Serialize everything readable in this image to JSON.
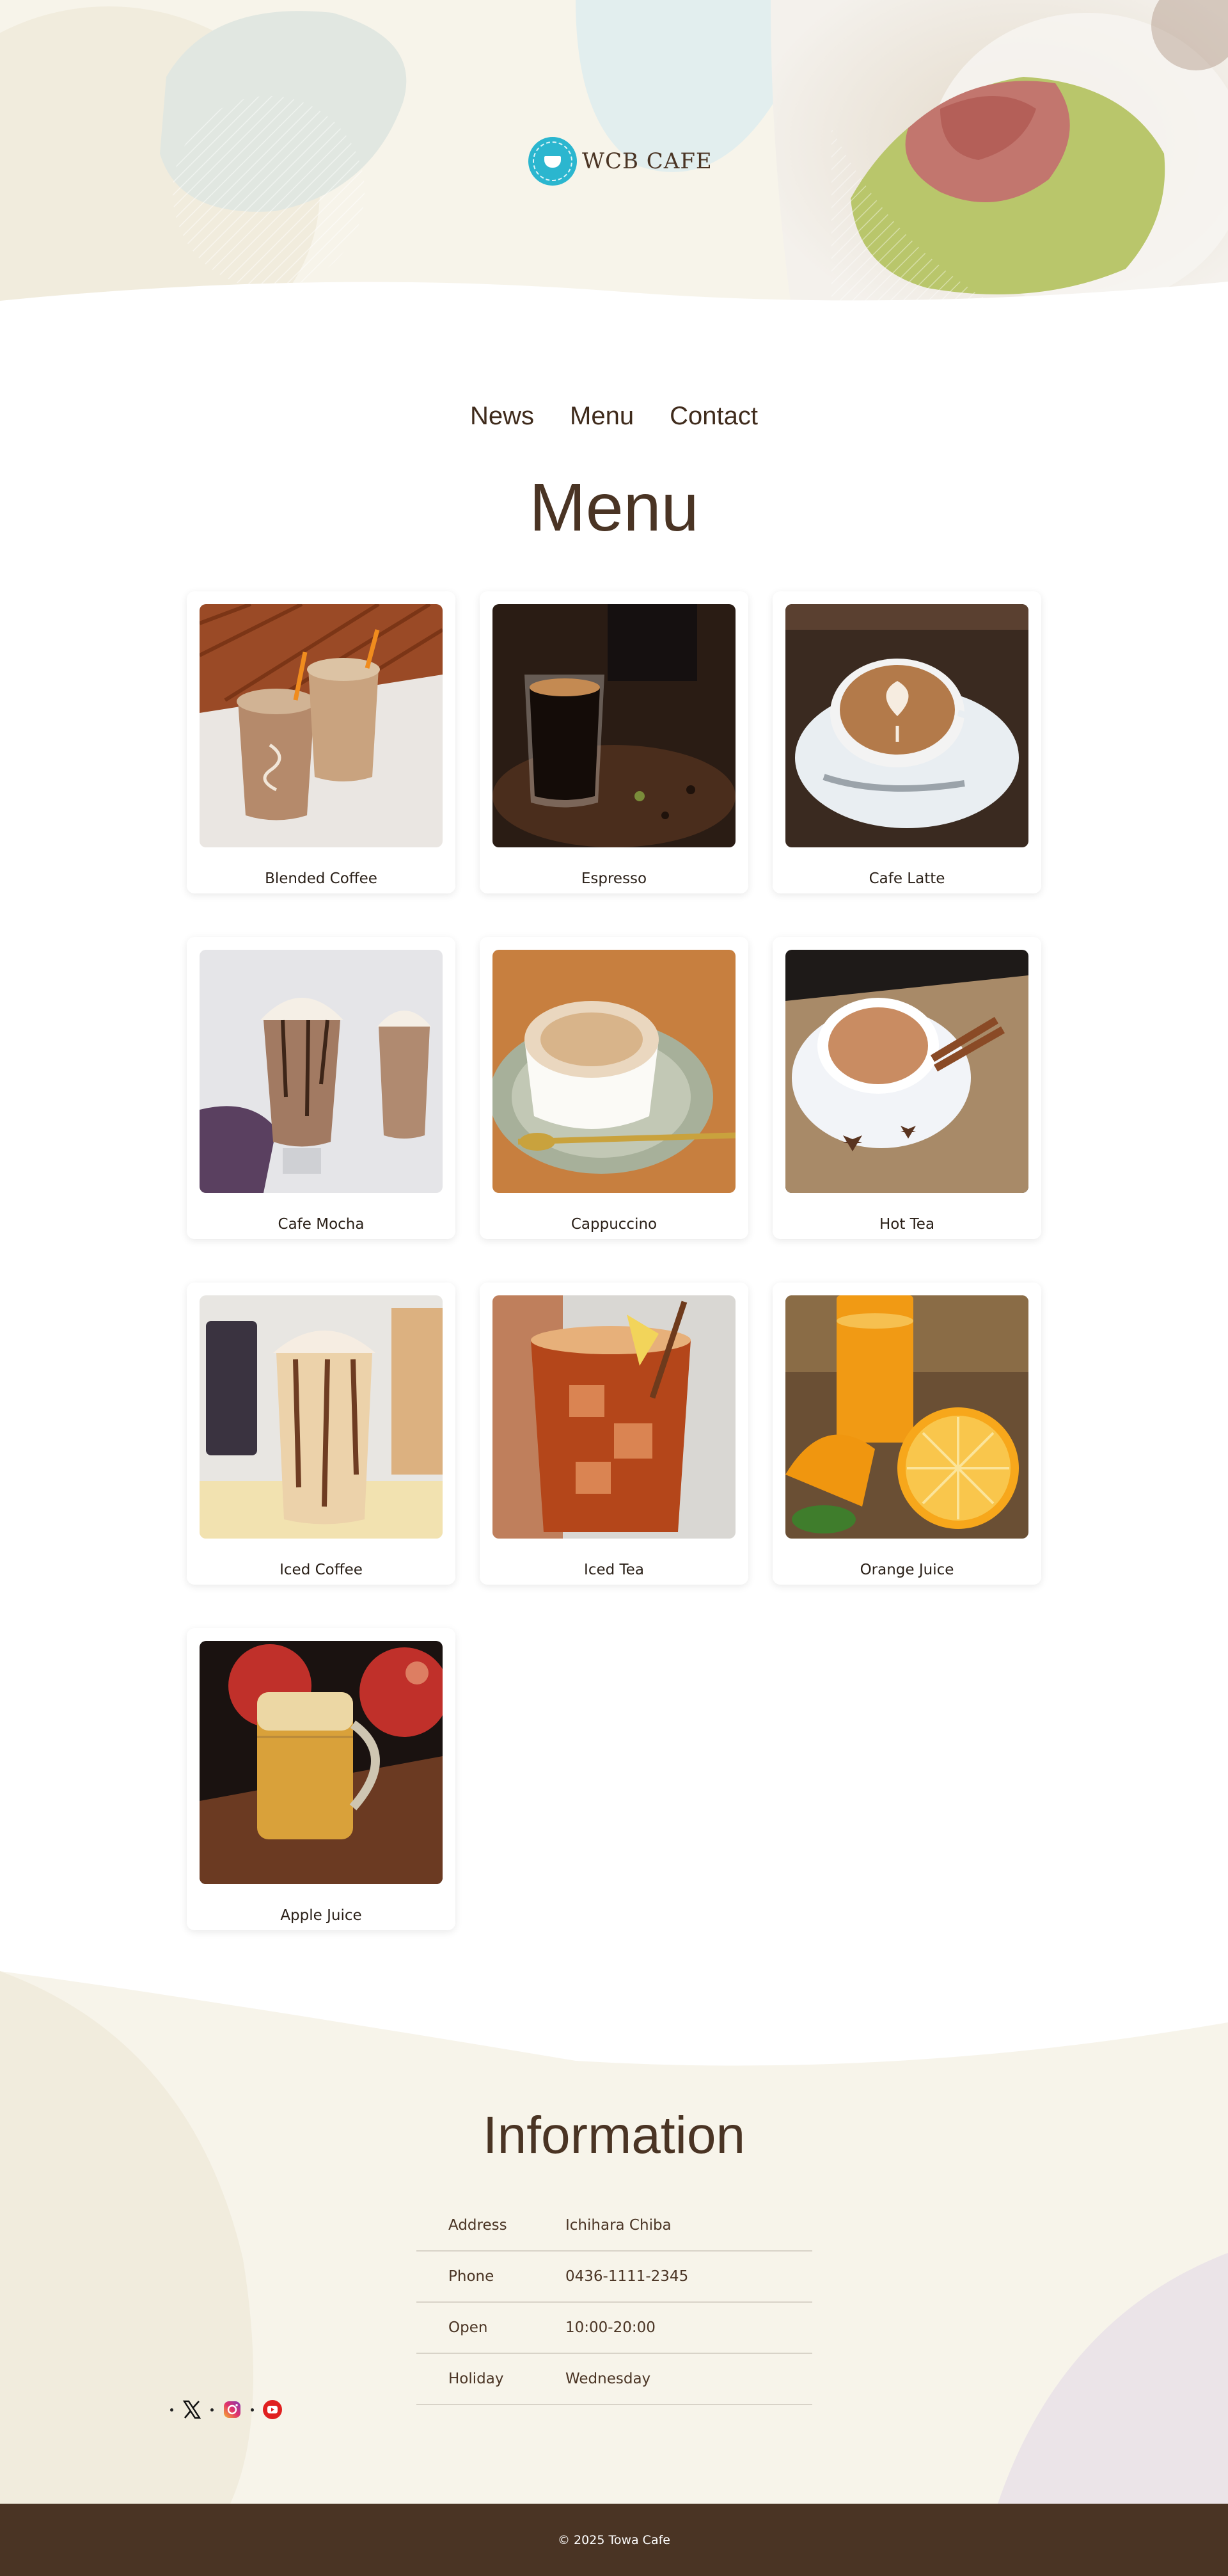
{
  "brand": {
    "name": "WCB CAFE"
  },
  "nav": [
    "News",
    "Menu",
    "Contact"
  ],
  "menu": {
    "title": "Menu",
    "items": [
      {
        "name": "Blended Coffee"
      },
      {
        "name": "Espresso"
      },
      {
        "name": "Cafe Latte"
      },
      {
        "name": "Cafe Mocha"
      },
      {
        "name": "Cappuccino"
      },
      {
        "name": "Hot Tea"
      },
      {
        "name": "Iced Coffee"
      },
      {
        "name": "Iced Tea"
      },
      {
        "name": "Orange Juice"
      },
      {
        "name": "Apple Juice"
      }
    ]
  },
  "info": {
    "title": "Information",
    "rows": [
      {
        "label": "Address",
        "value": "Ichihara Chiba"
      },
      {
        "label": "Phone",
        "value": "0436-1111-2345"
      },
      {
        "label": "Open",
        "value": "10:00-20:00"
      },
      {
        "label": "Holiday",
        "value": "Wednesday"
      }
    ]
  },
  "social": [
    "x-icon",
    "instagram-icon",
    "youtube-icon"
  ],
  "footer": {
    "copyright": "© 2025 Towa Cafe"
  },
  "colors": {
    "brand_brown": "#4a3424",
    "beige": "#f7f4ea",
    "logo_teal": "#2bb6cf"
  }
}
